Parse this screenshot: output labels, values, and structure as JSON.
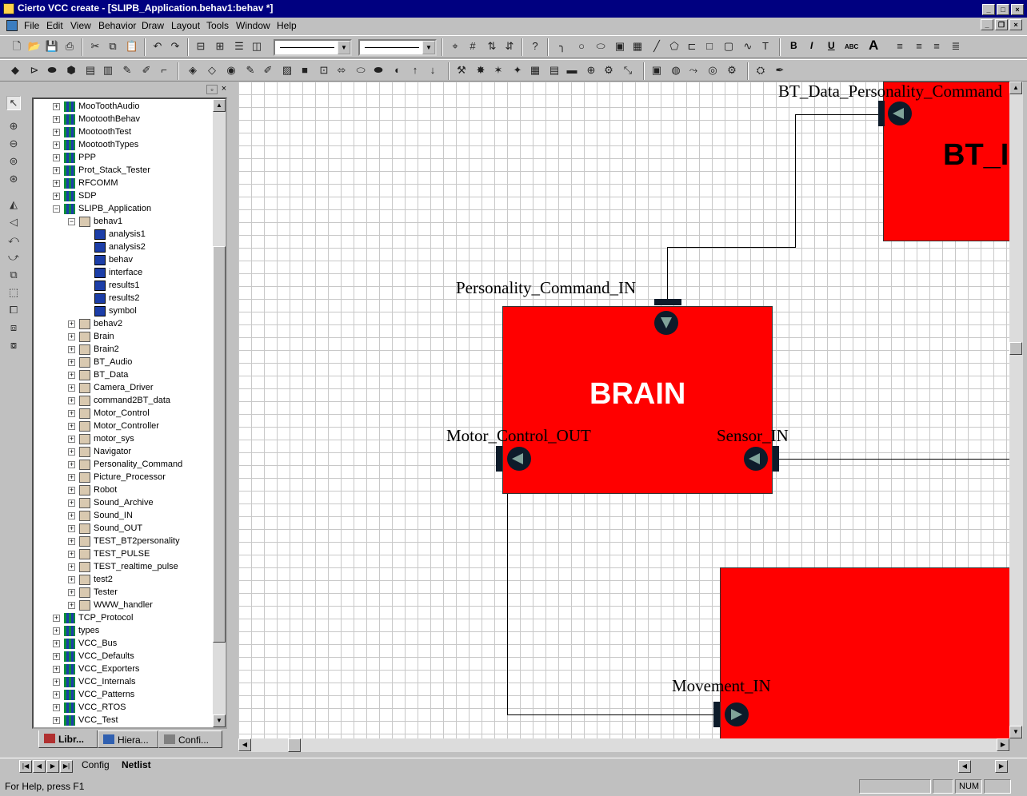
{
  "window": {
    "title": "Cierto VCC create - [SLIPB_Application.behav1:behav *]",
    "min_label": "_",
    "max_label": "□",
    "close_label": "×",
    "restore_label": "❐"
  },
  "menu": [
    "File",
    "Edit",
    "View",
    "Behavior",
    "Draw",
    "Layout",
    "Tools",
    "Window",
    "Help"
  ],
  "toolbar": {
    "text_buttons": {
      "bold": "B",
      "italic": "I",
      "underline": "U",
      "abc": "ABC",
      "font": "A"
    }
  },
  "library_tree": {
    "items": [
      {
        "label": "MooToothAudio",
        "level": 0,
        "kind": "lib",
        "expanded": false
      },
      {
        "label": "MootoothBehav",
        "level": 0,
        "kind": "lib",
        "expanded": false
      },
      {
        "label": "MootoothTest",
        "level": 0,
        "kind": "lib",
        "expanded": false
      },
      {
        "label": "MootoothTypes",
        "level": 0,
        "kind": "lib",
        "expanded": false
      },
      {
        "label": "PPP",
        "level": 0,
        "kind": "lib",
        "expanded": false
      },
      {
        "label": "Prot_Stack_Tester",
        "level": 0,
        "kind": "lib",
        "expanded": false
      },
      {
        "label": "RFCOMM",
        "level": 0,
        "kind": "lib",
        "expanded": false
      },
      {
        "label": "SDP",
        "level": 0,
        "kind": "lib",
        "expanded": false
      },
      {
        "label": "SLIPB_Application",
        "level": 0,
        "kind": "lib",
        "expanded": true
      },
      {
        "label": "behav1",
        "level": 1,
        "kind": "cell",
        "expanded": true
      },
      {
        "label": "analysis1",
        "level": 2,
        "kind": "view"
      },
      {
        "label": "analysis2",
        "level": 2,
        "kind": "view"
      },
      {
        "label": "behav",
        "level": 2,
        "kind": "view"
      },
      {
        "label": "interface",
        "level": 2,
        "kind": "view"
      },
      {
        "label": "results1",
        "level": 2,
        "kind": "view"
      },
      {
        "label": "results2",
        "level": 2,
        "kind": "view"
      },
      {
        "label": "symbol",
        "level": 2,
        "kind": "view"
      },
      {
        "label": "behav2",
        "level": 1,
        "kind": "cell",
        "expanded": false
      },
      {
        "label": "Brain",
        "level": 1,
        "kind": "cell",
        "expanded": false
      },
      {
        "label": "Brain2",
        "level": 1,
        "kind": "cell",
        "expanded": false
      },
      {
        "label": "BT_Audio",
        "level": 1,
        "kind": "cell",
        "expanded": false
      },
      {
        "label": "BT_Data",
        "level": 1,
        "kind": "cell",
        "expanded": false
      },
      {
        "label": "Camera_Driver",
        "level": 1,
        "kind": "cell",
        "expanded": false
      },
      {
        "label": "command2BT_data",
        "level": 1,
        "kind": "cell",
        "expanded": false
      },
      {
        "label": "Motor_Control",
        "level": 1,
        "kind": "cell",
        "expanded": false
      },
      {
        "label": "Motor_Controller",
        "level": 1,
        "kind": "cell",
        "expanded": false
      },
      {
        "label": "motor_sys",
        "level": 1,
        "kind": "cell",
        "expanded": false
      },
      {
        "label": "Navigator",
        "level": 1,
        "kind": "cell",
        "expanded": false
      },
      {
        "label": "Personality_Command",
        "level": 1,
        "kind": "cell",
        "expanded": false
      },
      {
        "label": "Picture_Processor",
        "level": 1,
        "kind": "cell",
        "expanded": false
      },
      {
        "label": "Robot",
        "level": 1,
        "kind": "cell",
        "expanded": false
      },
      {
        "label": "Sound_Archive",
        "level": 1,
        "kind": "cell",
        "expanded": false
      },
      {
        "label": "Sound_IN",
        "level": 1,
        "kind": "cell",
        "expanded": false
      },
      {
        "label": "Sound_OUT",
        "level": 1,
        "kind": "cell",
        "expanded": false
      },
      {
        "label": "TEST_BT2personality",
        "level": 1,
        "kind": "cell",
        "expanded": false
      },
      {
        "label": "TEST_PULSE",
        "level": 1,
        "kind": "cell",
        "expanded": false
      },
      {
        "label": "TEST_realtime_pulse",
        "level": 1,
        "kind": "cell",
        "expanded": false
      },
      {
        "label": "test2",
        "level": 1,
        "kind": "cell",
        "expanded": false
      },
      {
        "label": "Tester",
        "level": 1,
        "kind": "cell",
        "expanded": false
      },
      {
        "label": "WWW_handler",
        "level": 1,
        "kind": "cell",
        "expanded": false
      },
      {
        "label": "TCP_Protocol",
        "level": 0,
        "kind": "lib",
        "expanded": false
      },
      {
        "label": "types",
        "level": 0,
        "kind": "lib",
        "expanded": false
      },
      {
        "label": "VCC_Bus",
        "level": 0,
        "kind": "lib",
        "expanded": false
      },
      {
        "label": "VCC_Defaults",
        "level": 0,
        "kind": "lib",
        "expanded": false
      },
      {
        "label": "VCC_Exporters",
        "level": 0,
        "kind": "lib",
        "expanded": false
      },
      {
        "label": "VCC_Internals",
        "level": 0,
        "kind": "lib",
        "expanded": false
      },
      {
        "label": "VCC_Patterns",
        "level": 0,
        "kind": "lib",
        "expanded": false
      },
      {
        "label": "VCC_RTOS",
        "level": 0,
        "kind": "lib",
        "expanded": false
      },
      {
        "label": "VCC_Test",
        "level": 0,
        "kind": "lib",
        "expanded": false
      }
    ]
  },
  "panel_tabs": [
    "Libr...",
    "Hiera...",
    "Confi..."
  ],
  "diagram": {
    "blocks": {
      "brain": {
        "title": "BRAIN"
      },
      "bt": {
        "title": "BT_I"
      },
      "movement": {
        "title": ""
      }
    },
    "ports": {
      "bt_data_personality": "BT_Data_Personality_Command",
      "personality_in": "Personality_Command_IN",
      "motor_out": "Motor_Control_OUT",
      "sensor_in": "Sensor_IN",
      "movement_in": "Movement_IN"
    },
    "colors": {
      "block_fill": "#ff0000",
      "port_fill": "#0d1b2a",
      "arrow": "#7fa39a"
    }
  },
  "sheet_tabs": [
    "Config",
    "Netlist"
  ],
  "active_sheet_tab": "Netlist",
  "status": {
    "help": "For Help, press F1",
    "num": "NUM"
  }
}
